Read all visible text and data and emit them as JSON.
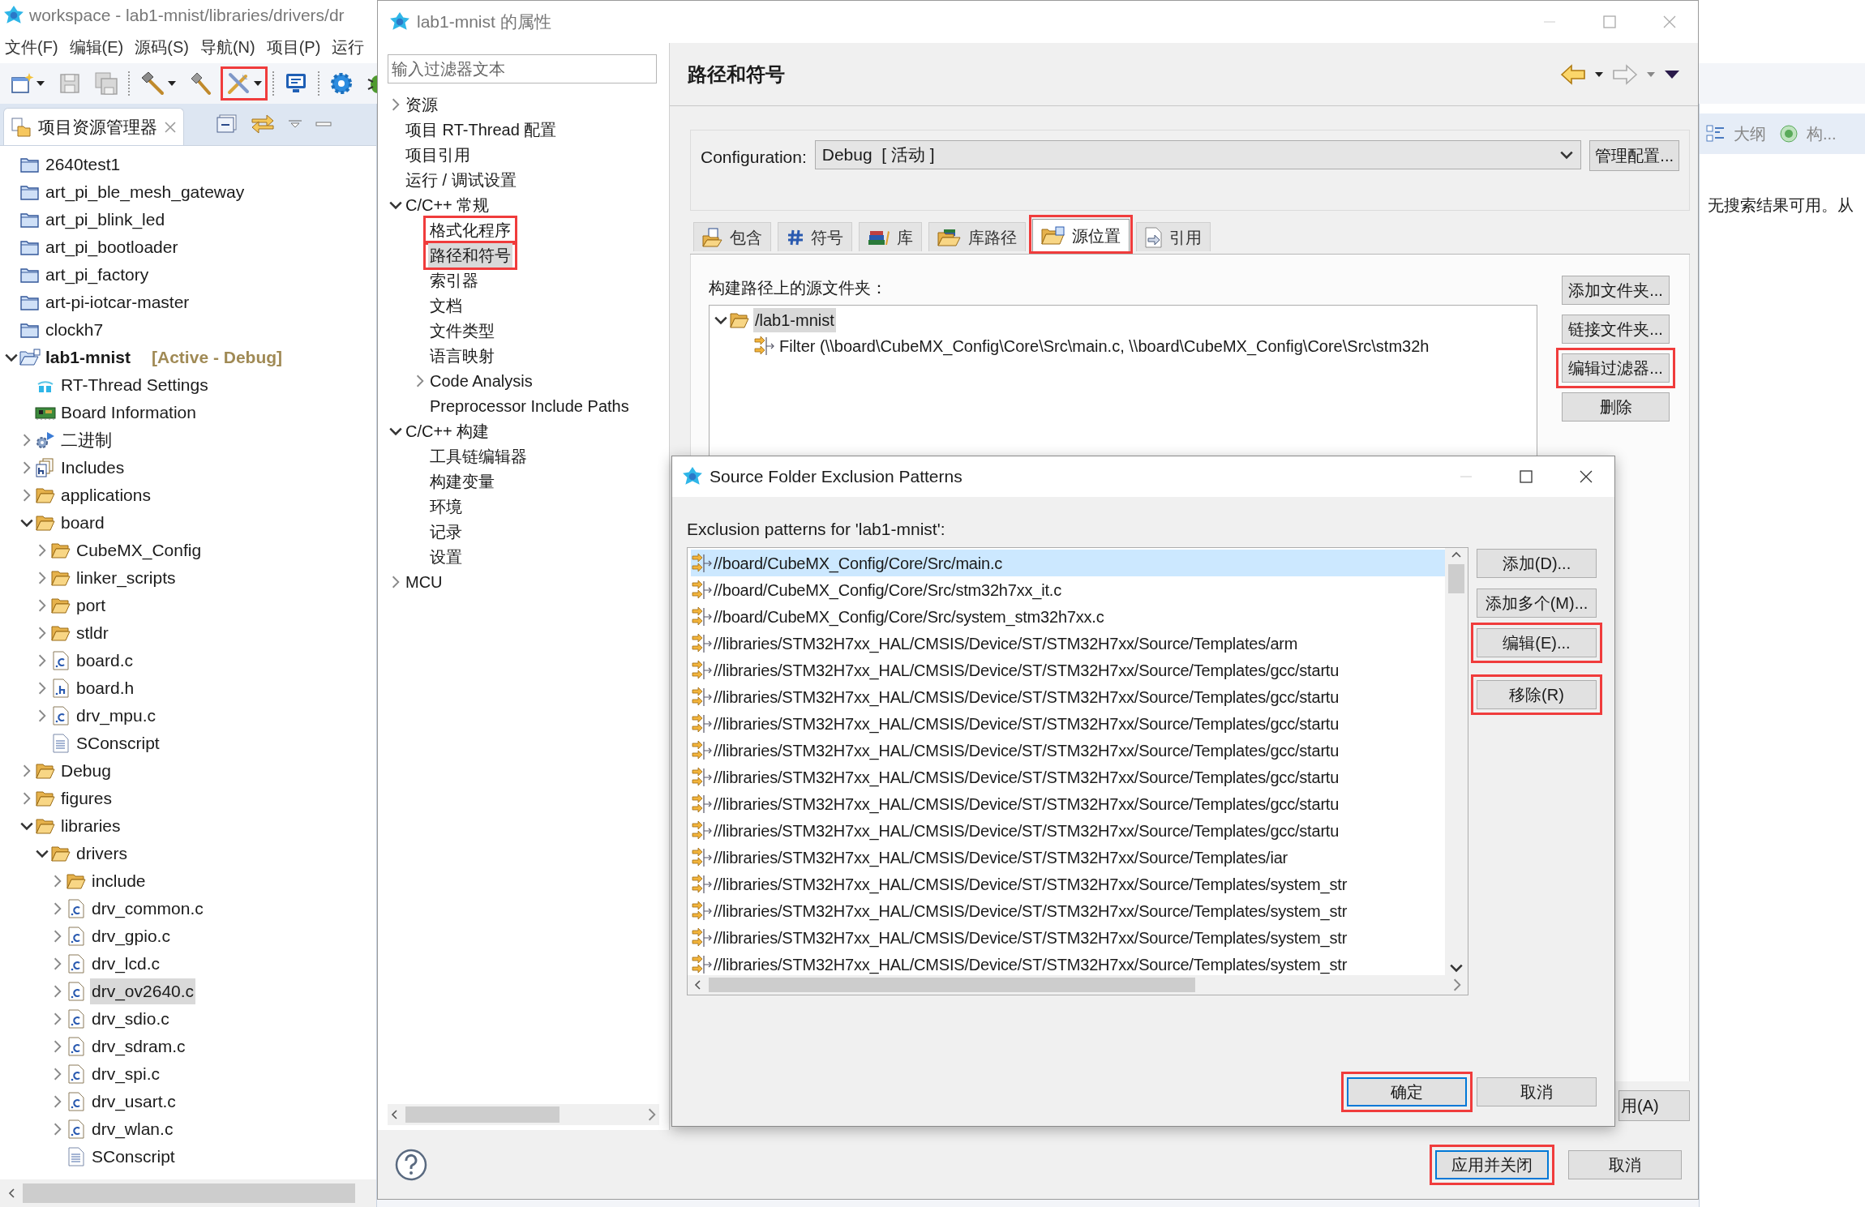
{
  "ide": {
    "title": "workspace - lab1-mnist/libraries/drivers/dr",
    "menu": [
      "文件(F)",
      "编辑(E)",
      "源码(S)",
      "导航(N)",
      "项目(P)",
      "运行"
    ],
    "toolbar": [
      {
        "kind": "new",
        "caret": true,
        "marked": false
      },
      {
        "kind": "save",
        "caret": false,
        "marked": false
      },
      {
        "kind": "save-all",
        "caret": false,
        "marked": false
      },
      {
        "kind": "hammer",
        "caret": true,
        "marked": false
      },
      {
        "kind": "brush",
        "caret": false,
        "marked": false
      },
      {
        "kind": "tools",
        "caret": true,
        "marked": true
      },
      {
        "kind": "monitor",
        "caret": false,
        "marked": false
      },
      {
        "kind": "gear",
        "caret": false,
        "marked": false
      },
      {
        "kind": "bug",
        "caret": false,
        "marked": false
      }
    ],
    "explorer": {
      "tab": "项目资源管理器",
      "tree": [
        {
          "label": "2640test1",
          "kind": "project",
          "expandable": false,
          "selected": false
        },
        {
          "label": "art_pi_ble_mesh_gateway",
          "kind": "project",
          "expandable": false,
          "selected": false
        },
        {
          "label": "art_pi_blink_led",
          "kind": "project",
          "expandable": false,
          "selected": false
        },
        {
          "label": "art_pi_bootloader",
          "kind": "project",
          "expandable": false,
          "selected": false
        },
        {
          "label": "art_pi_factory",
          "kind": "project",
          "expandable": false,
          "selected": false
        },
        {
          "label": "art-pi-iotcar-master",
          "kind": "project",
          "expandable": false,
          "selected": false
        },
        {
          "label": "clockh7",
          "kind": "project",
          "expandable": false,
          "selected": false
        },
        {
          "label": "lab1-mnist",
          "suffix": "[Active - Debug]",
          "kind": "project-open",
          "expandable": true,
          "expanded": true,
          "selected": false,
          "children": [
            {
              "label": "RT-Thread Settings",
              "kind": "rt",
              "expandable": false,
              "selected": false
            },
            {
              "label": "Board Information",
              "kind": "board",
              "expandable": false,
              "selected": false
            },
            {
              "label": "二进制",
              "kind": "binary",
              "expandable": true,
              "expanded": false,
              "selected": false
            },
            {
              "label": "Includes",
              "kind": "includes",
              "expandable": true,
              "expanded": false,
              "selected": false
            },
            {
              "label": "applications",
              "kind": "folder",
              "expandable": true,
              "expanded": false,
              "selected": false
            },
            {
              "label": "board",
              "kind": "folder",
              "expandable": true,
              "expanded": true,
              "selected": false,
              "children": [
                {
                  "label": "CubeMX_Config",
                  "kind": "folder",
                  "expandable": true,
                  "expanded": false,
                  "selected": false
                },
                {
                  "label": "linker_scripts",
                  "kind": "folder",
                  "expandable": true,
                  "expanded": false,
                  "selected": false
                },
                {
                  "label": "port",
                  "kind": "folder",
                  "expandable": true,
                  "expanded": false,
                  "selected": false
                },
                {
                  "label": "stldr",
                  "kind": "folder",
                  "expandable": true,
                  "expanded": false,
                  "selected": false
                },
                {
                  "label": "board.c",
                  "kind": "c-file",
                  "expandable": true,
                  "expanded": false,
                  "selected": false
                },
                {
                  "label": "board.h",
                  "kind": "h-file",
                  "expandable": true,
                  "expanded": false,
                  "selected": false
                },
                {
                  "label": "drv_mpu.c",
                  "kind": "c-file",
                  "expandable": true,
                  "expanded": false,
                  "selected": false
                },
                {
                  "label": "SConscript",
                  "kind": "text-file",
                  "expandable": false,
                  "selected": false
                }
              ]
            },
            {
              "label": "Debug",
              "kind": "folder",
              "expandable": true,
              "expanded": false,
              "selected": false
            },
            {
              "label": "figures",
              "kind": "folder",
              "expandable": true,
              "expanded": false,
              "selected": false
            },
            {
              "label": "libraries",
              "kind": "folder",
              "expandable": true,
              "expanded": true,
              "selected": false,
              "children": [
                {
                  "label": "drivers",
                  "kind": "folder",
                  "expandable": true,
                  "expanded": true,
                  "selected": false,
                  "children": [
                    {
                      "label": "include",
                      "kind": "folder",
                      "expandable": true,
                      "expanded": false,
                      "selected": false
                    },
                    {
                      "label": "drv_common.c",
                      "kind": "c-file",
                      "expandable": true,
                      "expanded": false,
                      "selected": false
                    },
                    {
                      "label": "drv_gpio.c",
                      "kind": "c-file",
                      "expandable": true,
                      "expanded": false,
                      "selected": false
                    },
                    {
                      "label": "drv_lcd.c",
                      "kind": "c-file",
                      "expandable": true,
                      "expanded": false,
                      "selected": false
                    },
                    {
                      "label": "drv_ov2640.c",
                      "kind": "c-file",
                      "expandable": true,
                      "expanded": false,
                      "selected": true
                    },
                    {
                      "label": "drv_sdio.c",
                      "kind": "c-file",
                      "expandable": true,
                      "expanded": false,
                      "selected": false
                    },
                    {
                      "label": "drv_sdram.c",
                      "kind": "c-file",
                      "expandable": true,
                      "expanded": false,
                      "selected": false
                    },
                    {
                      "label": "drv_spi.c",
                      "kind": "c-file",
                      "expandable": true,
                      "expanded": false,
                      "selected": false
                    },
                    {
                      "label": "drv_usart.c",
                      "kind": "c-file",
                      "expandable": true,
                      "expanded": false,
                      "selected": false
                    },
                    {
                      "label": "drv_wlan.c",
                      "kind": "c-file",
                      "expandable": true,
                      "expanded": false,
                      "selected": false
                    },
                    {
                      "label": "SConscript",
                      "kind": "text-file",
                      "expandable": false,
                      "selected": false
                    }
                  ]
                }
              ]
            }
          ]
        }
      ]
    },
    "side_tabs": [
      "大纲",
      "构..."
    ],
    "search_message": "无搜索结果可用。从"
  },
  "properties": {
    "title": "lab1-mnist 的属性",
    "filter": {
      "placeholder": "输入过滤器文本"
    },
    "nav": [
      {
        "label": "资源",
        "expandable": true,
        "expanded": false,
        "selected": false,
        "marked": false
      },
      {
        "label": "项目 RT-Thread 配置",
        "expandable": false,
        "selected": false,
        "marked": false
      },
      {
        "label": "项目引用",
        "expandable": false,
        "selected": false,
        "marked": false
      },
      {
        "label": "运行 / 调试设置",
        "expandable": false,
        "selected": false,
        "marked": false
      },
      {
        "label": "C/C++ 常规",
        "expandable": true,
        "expanded": true,
        "selected": false,
        "marked": false,
        "children": [
          {
            "label": "格式化程序",
            "expandable": false,
            "selected": false,
            "marked": true
          },
          {
            "label": "路径和符号",
            "expandable": false,
            "selected": true,
            "marked": true
          },
          {
            "label": "索引器",
            "expandable": false,
            "selected": false,
            "marked": false
          },
          {
            "label": "文档",
            "expandable": false,
            "selected": false,
            "marked": false
          },
          {
            "label": "文件类型",
            "expandable": false,
            "selected": false,
            "marked": false
          },
          {
            "label": "语言映射",
            "expandable": false,
            "selected": false,
            "marked": false
          },
          {
            "label": "Code Analysis",
            "expandable": true,
            "expanded": false,
            "selected": false,
            "marked": false
          },
          {
            "label": "Preprocessor Include Paths",
            "expandable": false,
            "selected": false,
            "marked": false
          }
        ]
      },
      {
        "label": "C/C++ 构建",
        "expandable": true,
        "expanded": true,
        "selected": false,
        "marked": false,
        "children": [
          {
            "label": "工具链编辑器",
            "expandable": false,
            "selected": false,
            "marked": false
          },
          {
            "label": "构建变量",
            "expandable": false,
            "selected": false,
            "marked": false
          },
          {
            "label": "环境",
            "expandable": false,
            "selected": false,
            "marked": false
          },
          {
            "label": "记录",
            "expandable": false,
            "selected": false,
            "marked": false
          },
          {
            "label": "设置",
            "expandable": false,
            "selected": false,
            "marked": false
          }
        ]
      },
      {
        "label": "MCU",
        "expandable": true,
        "expanded": false,
        "selected": false,
        "marked": false
      }
    ],
    "page_title": "路径和符号",
    "configuration": {
      "label": "Configuration:",
      "value": "Debug  [ 活动 ]",
      "button": "管理配置..."
    },
    "tabs": [
      {
        "label": "包含",
        "kind": "include",
        "selected": false,
        "marked": false
      },
      {
        "label": "符号",
        "kind": "hash",
        "selected": false,
        "marked": false
      },
      {
        "label": "库",
        "kind": "books",
        "selected": false,
        "marked": false
      },
      {
        "label": "库路径",
        "kind": "folder",
        "selected": false,
        "marked": false
      },
      {
        "label": "源位置",
        "kind": "source",
        "selected": true,
        "marked": true
      },
      {
        "label": "引用",
        "kind": "reference",
        "selected": false,
        "marked": false
      }
    ],
    "source_label": "构建路径上的源文件夹：",
    "source_tree": [
      {
        "label": "/lab1-mnist",
        "kind": "folder",
        "expandable": true,
        "expanded": true,
        "selected": true,
        "children": [
          {
            "label": "Filter (\\\\board\\CubeMX_Config\\Core\\Src\\main.c, \\\\board\\CubeMX_Config\\Core\\Src\\stm32h",
            "kind": "pattern",
            "expandable": false,
            "selected": false
          }
        ]
      }
    ],
    "side_buttons": [
      {
        "label": "添加文件夹...",
        "marked": false
      },
      {
        "label": "链接文件夹...",
        "marked": false
      },
      {
        "label": "编辑过滤器...",
        "marked": true
      },
      {
        "label": "删除",
        "marked": false
      }
    ],
    "apply_button": "用(A)",
    "footer_buttons": [
      {
        "label": "应用并关闭",
        "default": true,
        "marked": true
      },
      {
        "label": "取消",
        "default": false,
        "marked": false
      }
    ]
  },
  "exclusion_dialog": {
    "title": "Source Folder Exclusion Patterns",
    "label": "Exclusion patterns for 'lab1-mnist':",
    "patterns": [
      {
        "text": "//board/CubeMX_Config/Core/Src/main.c",
        "selected": true
      },
      {
        "text": "//board/CubeMX_Config/Core/Src/stm32h7xx_it.c",
        "selected": false
      },
      {
        "text": "//board/CubeMX_Config/Core/Src/system_stm32h7xx.c",
        "selected": false
      },
      {
        "text": "//libraries/STM32H7xx_HAL/CMSIS/Device/ST/STM32H7xx/Source/Templates/arm",
        "selected": false
      },
      {
        "text": "//libraries/STM32H7xx_HAL/CMSIS/Device/ST/STM32H7xx/Source/Templates/gcc/startu",
        "selected": false
      },
      {
        "text": "//libraries/STM32H7xx_HAL/CMSIS/Device/ST/STM32H7xx/Source/Templates/gcc/startu",
        "selected": false
      },
      {
        "text": "//libraries/STM32H7xx_HAL/CMSIS/Device/ST/STM32H7xx/Source/Templates/gcc/startu",
        "selected": false
      },
      {
        "text": "//libraries/STM32H7xx_HAL/CMSIS/Device/ST/STM32H7xx/Source/Templates/gcc/startu",
        "selected": false
      },
      {
        "text": "//libraries/STM32H7xx_HAL/CMSIS/Device/ST/STM32H7xx/Source/Templates/gcc/startu",
        "selected": false
      },
      {
        "text": "//libraries/STM32H7xx_HAL/CMSIS/Device/ST/STM32H7xx/Source/Templates/gcc/startu",
        "selected": false
      },
      {
        "text": "//libraries/STM32H7xx_HAL/CMSIS/Device/ST/STM32H7xx/Source/Templates/gcc/startu",
        "selected": false
      },
      {
        "text": "//libraries/STM32H7xx_HAL/CMSIS/Device/ST/STM32H7xx/Source/Templates/iar",
        "selected": false
      },
      {
        "text": "//libraries/STM32H7xx_HAL/CMSIS/Device/ST/STM32H7xx/Source/Templates/system_str",
        "selected": false
      },
      {
        "text": "//libraries/STM32H7xx_HAL/CMSIS/Device/ST/STM32H7xx/Source/Templates/system_str",
        "selected": false
      },
      {
        "text": "//libraries/STM32H7xx_HAL/CMSIS/Device/ST/STM32H7xx/Source/Templates/system_str",
        "selected": false
      },
      {
        "text": "//libraries/STM32H7xx_HAL/CMSIS/Device/ST/STM32H7xx/Source/Templates/system_str",
        "selected": false
      }
    ],
    "side_buttons": [
      {
        "label": "添加(D)...",
        "marked": false
      },
      {
        "label": "添加多个(M)...",
        "marked": false
      },
      {
        "label": "编辑(E)...",
        "marked": true
      },
      {
        "label": "移除(R)",
        "marked": true
      }
    ],
    "footer_buttons": [
      {
        "label": "确定",
        "default": true,
        "marked": true
      },
      {
        "label": "取消",
        "default": false,
        "marked": false
      }
    ]
  }
}
